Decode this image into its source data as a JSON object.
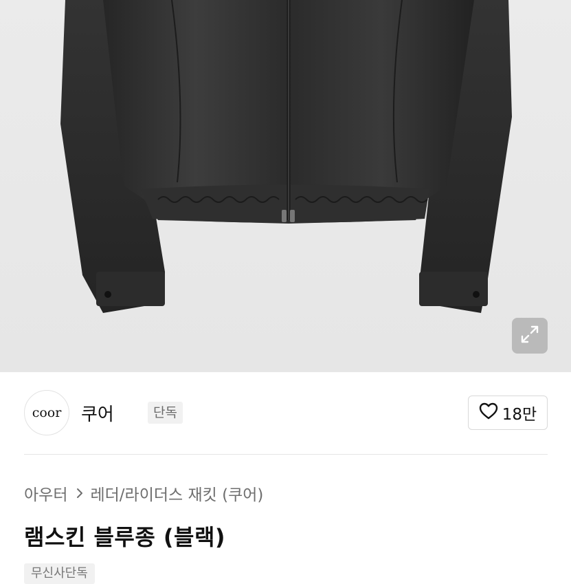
{
  "product_image": {
    "alt": "",
    "expand_icon": "expand-icon"
  },
  "brand": {
    "logo_text": "coor",
    "name": "쿠어",
    "badge": "단독"
  },
  "like": {
    "icon": "heart-outline-icon",
    "count": "18만"
  },
  "breadcrumb": {
    "category": "아우터",
    "separator_icon": "chevron-right-icon",
    "subcategory": "레더/라이더스 재킷 (쿠어)"
  },
  "product": {
    "title": "램스킨 블루종 (블랙)",
    "tag": "무신사단독"
  },
  "colors": {
    "background": "#ffffff",
    "hero_background": "#e8e8e8",
    "text_primary": "#111111",
    "text_secondary": "#6e6e6e"
  }
}
